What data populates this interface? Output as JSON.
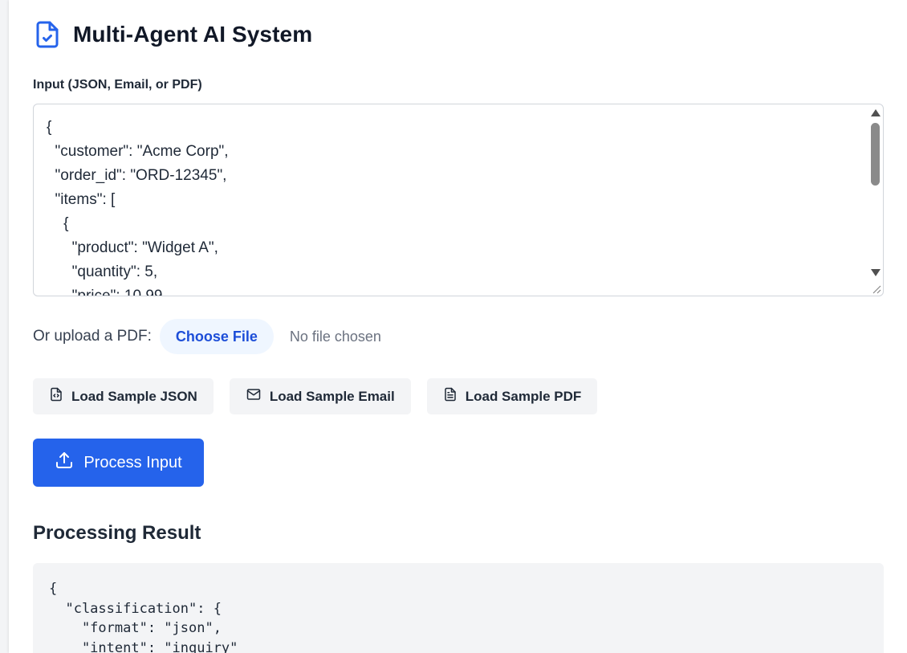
{
  "header": {
    "icon": "file-check-icon",
    "title": "Multi-Agent AI System",
    "accent_color": "#2563eb"
  },
  "input": {
    "label": "Input (JSON, Email, or PDF)",
    "value": "{\n  \"customer\": \"Acme Corp\",\n  \"order_id\": \"ORD-12345\",\n  \"items\": [\n    {\n      \"product\": \"Widget A\",\n      \"quantity\": 5,\n      \"price\": 10.99"
  },
  "upload": {
    "label": "Or upload a PDF:",
    "button_label": "Choose File",
    "status": "No file chosen"
  },
  "samples": {
    "json": {
      "label": "Load Sample JSON",
      "icon": "file-code-icon"
    },
    "email": {
      "label": "Load Sample Email",
      "icon": "mail-icon"
    },
    "pdf": {
      "label": "Load Sample PDF",
      "icon": "file-text-icon"
    }
  },
  "process": {
    "label": "Process Input",
    "icon": "upload-icon",
    "color": "#2563eb"
  },
  "result": {
    "title": "Processing Result",
    "output": "{\n  \"classification\": {\n    \"format\": \"json\",\n    \"intent\": \"inquiry\""
  }
}
